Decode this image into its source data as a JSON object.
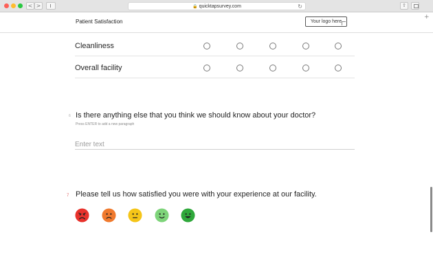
{
  "browser": {
    "url": "quicktapsurvey.com",
    "back_icon": "chevron-left-icon",
    "forward_icon": "chevron-right-icon",
    "back_glyph": "<",
    "forward_glyph": ">",
    "share_glyph": "⇧",
    "reload_glyph": "↻",
    "lock_glyph": "🔒",
    "newtab_glyph": "+"
  },
  "header": {
    "title": "Patient Satisfaction",
    "logo_placeholder": "Your logo here"
  },
  "matrix": {
    "rows": [
      {
        "label": "Cleanliness"
      },
      {
        "label": "Overall facility"
      }
    ],
    "options_per_row": 5
  },
  "question6": {
    "number": "6",
    "text": "Is there anything else that you think we should know about your doctor?",
    "hint": "Press ENTER to add a new paragraph",
    "placeholder": "Enter text"
  },
  "question7": {
    "number": "7",
    "text": "Please tell us how satisfied you were with your experience at our facility.",
    "faces": [
      {
        "name": "very-dissatisfied-face-icon",
        "color": "#e8322c"
      },
      {
        "name": "dissatisfied-face-icon",
        "color": "#f07a2e"
      },
      {
        "name": "neutral-face-icon",
        "color": "#f5c518"
      },
      {
        "name": "satisfied-face-icon",
        "color": "#7ed47a"
      },
      {
        "name": "very-satisfied-face-icon",
        "color": "#2fa83b"
      }
    ]
  }
}
